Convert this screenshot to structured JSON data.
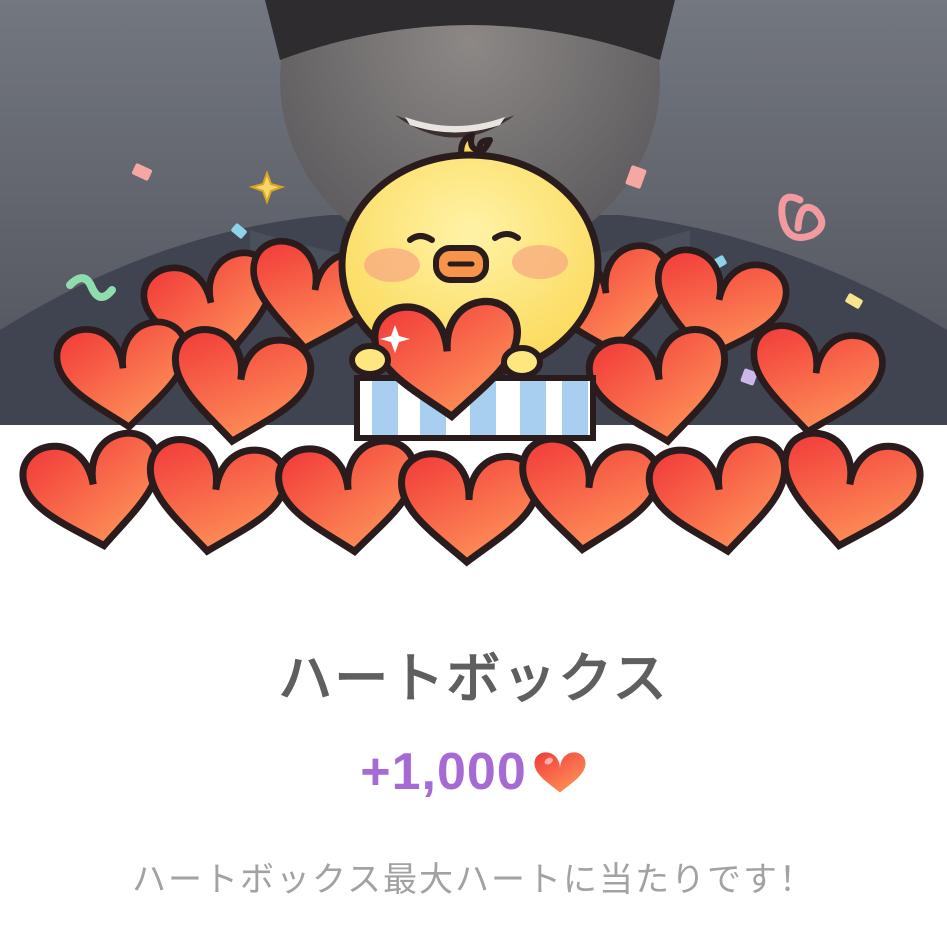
{
  "popup": {
    "title": "ハートボックス",
    "reward_amount": "+1,000",
    "reward_icon": "heart-icon",
    "caption": "ハートボックス最大ハートに当たりです！"
  },
  "colors": {
    "title": "#5f5f5f",
    "reward_amount": "#a56ad4",
    "caption": "#a2a2a2",
    "heart_light": "#ff9a5a",
    "heart_dark": "#f0413a",
    "chick_body": "#fde77e",
    "backdrop": "#5a5d66"
  }
}
